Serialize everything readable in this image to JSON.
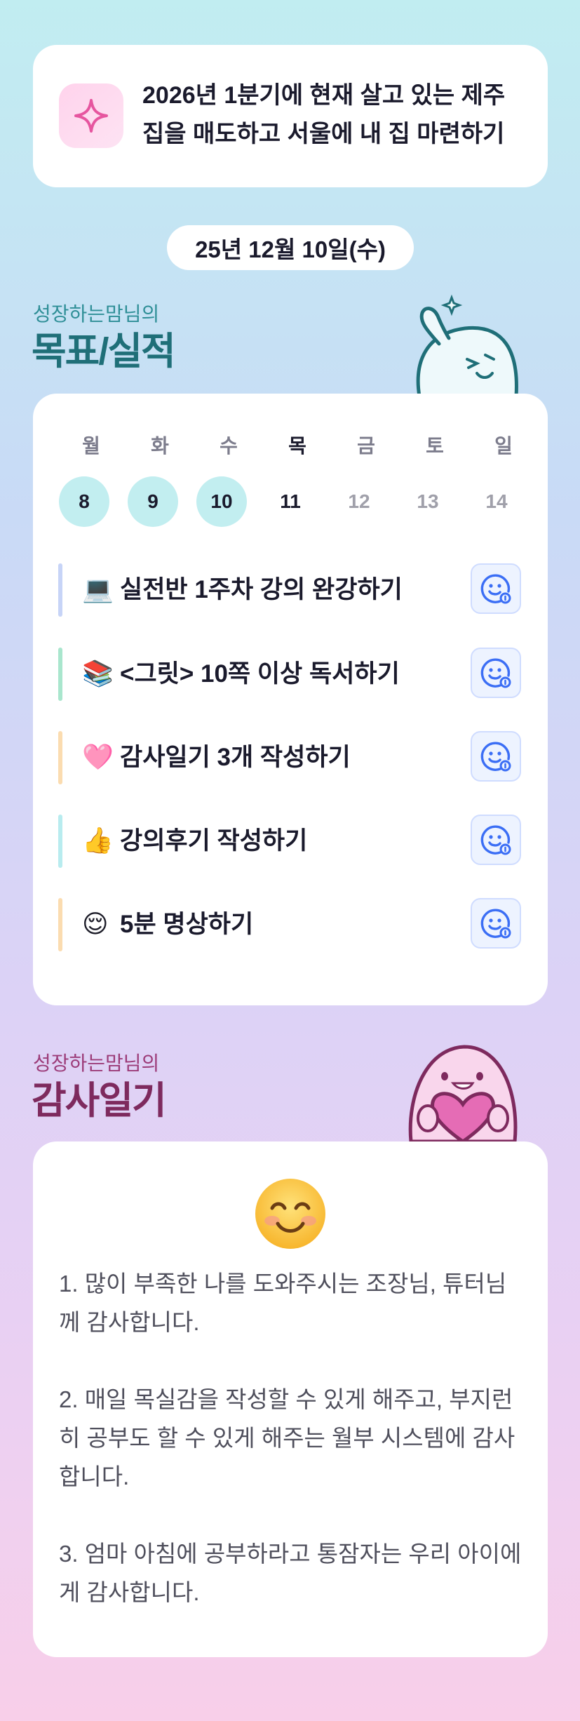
{
  "goal": {
    "icon": "sparkle-icon",
    "text": "2026년 1분기에 현재 살고 있는 제주 집을 매도하고 서울에 내 집 마련하기"
  },
  "date": "25년 12월 10일(수)",
  "goals_section": {
    "subtitle": "성장하는맘님의",
    "title": "목표/실적",
    "mascot": "waving-mascot-icon"
  },
  "week": {
    "days": [
      {
        "label": "월",
        "num": "8",
        "state": "done"
      },
      {
        "label": "화",
        "num": "9",
        "state": "done"
      },
      {
        "label": "수",
        "num": "10",
        "state": "done"
      },
      {
        "label": "목",
        "num": "11",
        "state": "today"
      },
      {
        "label": "금",
        "num": "12",
        "state": "future"
      },
      {
        "label": "토",
        "num": "13",
        "state": "future"
      },
      {
        "label": "일",
        "num": "14",
        "state": "future"
      }
    ]
  },
  "tasks": [
    {
      "emoji": "💻",
      "text": "실전반 1주차 강의 완강하기",
      "bar_color": "#c7d4f7",
      "button_icon": "smile-face-add-icon"
    },
    {
      "emoji": "📚",
      "text": "<그릿> 10쪽 이상 독서하기",
      "bar_color": "#a9e6cd",
      "button_icon": "smile-face-add-icon"
    },
    {
      "emoji": "🩷",
      "text": "감사일기 3개 작성하기",
      "bar_color": "#fbdcb0",
      "button_icon": "smile-face-add-icon"
    },
    {
      "emoji": "👍",
      "text": "강의후기 작성하기",
      "bar_color": "#b8ecef",
      "button_icon": "smile-face-add-icon"
    },
    {
      "emoji": "😌",
      "text": "5분 명상하기",
      "bar_color": "#fbdcb0",
      "button_icon": "smile-face-add-icon"
    }
  ],
  "diary_section": {
    "subtitle": "성장하는맘님의",
    "title": "감사일기",
    "mascot": "heart-mascot-icon"
  },
  "diary": {
    "emoji": "smiling-face-icon",
    "entries": [
      "1. 많이 부족한 나를 도와주시는 조장님, 튜터님께 감사합니다.",
      "2. 매일 목실감을 작성할 수 있게 해주고, 부지런히 공부도 할 수 있게 해주는 월부 시스템에 감사합니다.",
      "3. 엄마 아침에 공부하라고 통잠자는 우리 아이에게 감사합니다."
    ]
  },
  "colors": {
    "accent_blue": "#3b6ef5",
    "done_day": "#c2eef0",
    "teal_title": "#1f6f78",
    "plum_title": "#7e2a5e"
  }
}
